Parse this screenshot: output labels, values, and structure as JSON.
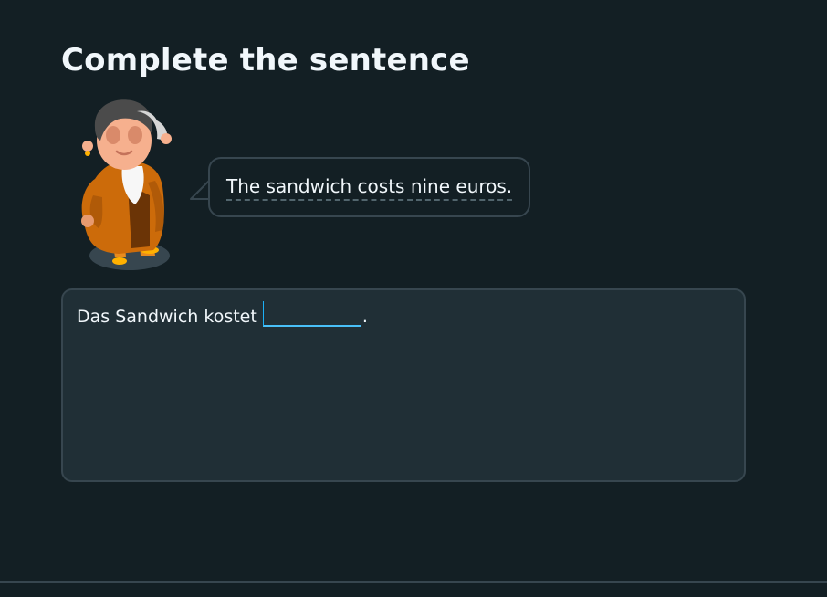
{
  "header": {
    "title": "Complete the sentence"
  },
  "prompt": {
    "speaker_icon": "character-woman-icon",
    "sentence": "The sandwich costs nine euros."
  },
  "answer": {
    "prefix": "Das Sandwich kostet",
    "input_value": "",
    "suffix": "."
  },
  "colors": {
    "background": "#131f24",
    "panel": "#202f36",
    "border": "#37464f",
    "input_accent": "#1cb0f6",
    "text": "#f1f7fb"
  }
}
